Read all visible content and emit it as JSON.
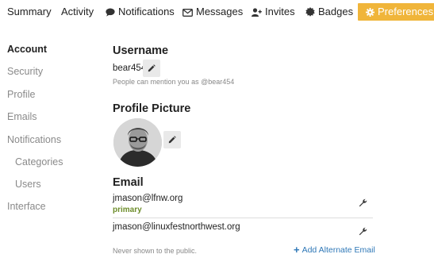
{
  "nav": {
    "tabs": [
      {
        "label": "Summary",
        "icon": null,
        "active": false
      },
      {
        "label": "Activity",
        "icon": null,
        "active": false
      },
      {
        "label": "Notifications",
        "icon": "comment-icon",
        "active": false
      },
      {
        "label": "Messages",
        "icon": "envelope-icon",
        "active": false
      },
      {
        "label": "Invites",
        "icon": "user-plus-icon",
        "active": false
      },
      {
        "label": "Badges",
        "icon": "certificate-icon",
        "active": false
      },
      {
        "label": "Preferences",
        "icon": "gear-icon",
        "active": true
      }
    ],
    "active_color": "#f0b53a"
  },
  "sidebar": {
    "items": [
      {
        "label": "Account",
        "active": true
      },
      {
        "label": "Security",
        "active": false
      },
      {
        "label": "Profile",
        "active": false
      },
      {
        "label": "Emails",
        "active": false
      },
      {
        "label": "Notifications",
        "active": false
      },
      {
        "label": "Categories",
        "active": false,
        "sub": true
      },
      {
        "label": "Users",
        "active": false,
        "sub": true
      },
      {
        "label": "Interface",
        "active": false
      }
    ]
  },
  "username": {
    "heading": "Username",
    "value": "bear454",
    "hint": "People can mention you as @bear454"
  },
  "profile_picture": {
    "heading": "Profile Picture"
  },
  "email": {
    "heading": "Email",
    "addresses": [
      {
        "address": "jmason@lfnw.org",
        "badge": "primary"
      },
      {
        "address": "jmason@linuxfestnorthwest.org",
        "badge": ""
      }
    ],
    "note": "Never shown to the public.",
    "add_label": "Add Alternate Email",
    "primary_color": "#6d8d2b",
    "link_color": "#2f78b7"
  }
}
